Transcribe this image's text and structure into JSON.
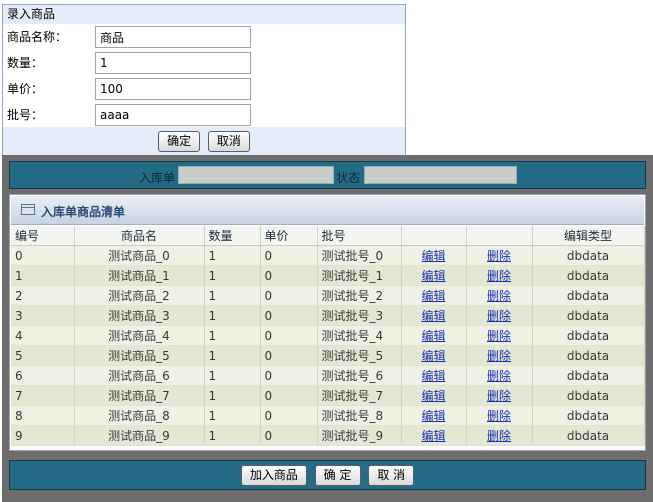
{
  "form": {
    "title": "录入商品",
    "fields": [
      {
        "label": "商品名称：",
        "value": "商品"
      },
      {
        "label": "数量：",
        "value": "1"
      },
      {
        "label": "单价：",
        "value": "100"
      },
      {
        "label": "批号：",
        "value": "aaaa"
      }
    ],
    "confirm_label": "确定",
    "cancel_label": "取消"
  },
  "filter": {
    "order_label": "入库单",
    "order_value": "",
    "status_label": "状态",
    "status_value": ""
  },
  "list": {
    "title": "入库单商品清单",
    "columns": [
      "编号",
      "商品名",
      "数量",
      "单价",
      "批号",
      "",
      "",
      "编辑类型"
    ],
    "rows": [
      {
        "id": "0",
        "name": "测试商品_0",
        "qty": "1",
        "price": "0",
        "batch": "测试批号_0",
        "edit": "编辑",
        "del": "删除",
        "type": "dbdata"
      },
      {
        "id": "1",
        "name": "测试商品_1",
        "qty": "1",
        "price": "0",
        "batch": "测试批号_1",
        "edit": "编辑",
        "del": "删除",
        "type": "dbdata"
      },
      {
        "id": "2",
        "name": "测试商品_2",
        "qty": "1",
        "price": "0",
        "batch": "测试批号_2",
        "edit": "编辑",
        "del": "删除",
        "type": "dbdata"
      },
      {
        "id": "3",
        "name": "测试商品_3",
        "qty": "1",
        "price": "0",
        "batch": "测试批号_3",
        "edit": "编辑",
        "del": "删除",
        "type": "dbdata"
      },
      {
        "id": "4",
        "name": "测试商品_4",
        "qty": "1",
        "price": "0",
        "batch": "测试批号_4",
        "edit": "编辑",
        "del": "删除",
        "type": "dbdata"
      },
      {
        "id": "5",
        "name": "测试商品_5",
        "qty": "1",
        "price": "0",
        "batch": "测试批号_5",
        "edit": "编辑",
        "del": "删除",
        "type": "dbdata"
      },
      {
        "id": "6",
        "name": "测试商品_6",
        "qty": "1",
        "price": "0",
        "batch": "测试批号_6",
        "edit": "编辑",
        "del": "删除",
        "type": "dbdata"
      },
      {
        "id": "7",
        "name": "测试商品_7",
        "qty": "1",
        "price": "0",
        "batch": "测试批号_7",
        "edit": "编辑",
        "del": "删除",
        "type": "dbdata"
      },
      {
        "id": "8",
        "name": "测试商品_8",
        "qty": "1",
        "price": "0",
        "batch": "测试批号_8",
        "edit": "编辑",
        "del": "删除",
        "type": "dbdata"
      },
      {
        "id": "9",
        "name": "测试商品_9",
        "qty": "1",
        "price": "0",
        "batch": "测试批号_9",
        "edit": "编辑",
        "del": "删除",
        "type": "dbdata"
      }
    ]
  },
  "bottom": {
    "add_label": "加入商品",
    "confirm_label": "确 定",
    "cancel_label": "取 消"
  },
  "icons": {
    "list_header": "table-icon"
  },
  "colors": {
    "panel_bar": "#246b85",
    "panel_bg": "#6d6d6d",
    "form_header": "#e4edf9",
    "link": "#1a2fb5"
  }
}
